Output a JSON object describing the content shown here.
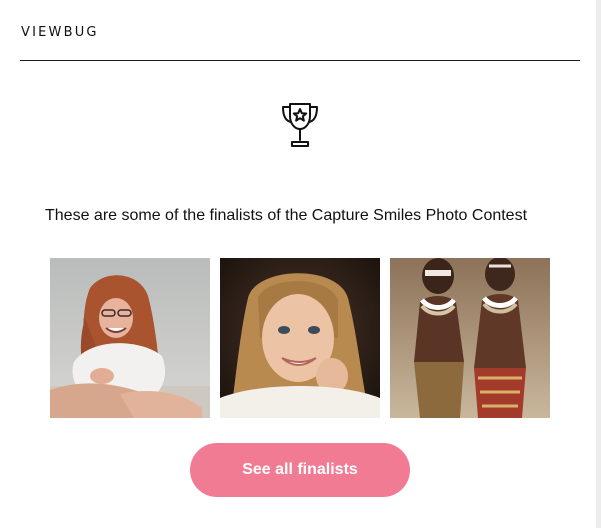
{
  "header": {
    "brand": "VIEWBUG"
  },
  "hero": {
    "icon": "trophy-icon"
  },
  "content": {
    "headline": "These are some of the finalists of the Capture Smiles Photo Contest"
  },
  "photos": [
    {
      "name": "finalist-photo-1",
      "subject": "laughing woman with red hair sitting cross-legged"
    },
    {
      "name": "finalist-photo-2",
      "subject": "smiling girl with long blonde hair"
    },
    {
      "name": "finalist-photo-3",
      "subject": "two smiling children with face paint and beads"
    }
  ],
  "cta": {
    "label": "See all finalists"
  },
  "colors": {
    "accent": "#f27b94",
    "text": "#111111",
    "divider": "#1a1a1a"
  }
}
